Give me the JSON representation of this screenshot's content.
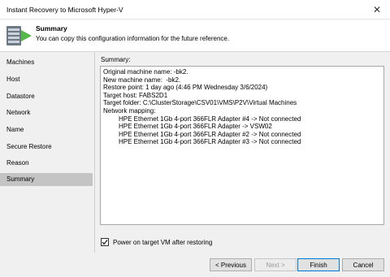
{
  "window": {
    "title": "Instant Recovery to Microsoft Hyper-V",
    "close_glyph": "✕"
  },
  "header": {
    "title": "Summary",
    "description": "You can copy this configuration information for the future reference."
  },
  "sidebar": {
    "items": [
      {
        "label": "Machines"
      },
      {
        "label": "Host"
      },
      {
        "label": "Datastore"
      },
      {
        "label": "Network"
      },
      {
        "label": "Name"
      },
      {
        "label": "Secure Restore"
      },
      {
        "label": "Reason"
      },
      {
        "label": "Summary"
      }
    ],
    "active_index": 7
  },
  "main": {
    "summary_label": "Summary:",
    "summary_lines": [
      {
        "text": "Original machine name:        -bk2.",
        "indent": false
      },
      {
        "text": "New machine name:         -bk2.",
        "indent": false
      },
      {
        "text": "Restore point: 1 day ago (4:46 PM Wednesday 3/6/2024)",
        "indent": false
      },
      {
        "text": "Target host: FABS2D1",
        "indent": false
      },
      {
        "text": "Target folder: C:\\ClusterStorage\\CSV01\\VMS\\P2V\\Virtual Machines",
        "indent": false
      },
      {
        "text": "Network mapping:",
        "indent": false
      },
      {
        "text": "HPE Ethernet 1Gb 4-port 366FLR Adapter #4 -> Not connected",
        "indent": true
      },
      {
        "text": "HPE Ethernet 1Gb 4-port 366FLR Adapter -> VSW02",
        "indent": true
      },
      {
        "text": "HPE Ethernet 1Gb 4-port 366FLR Adapter #2 -> Not connected",
        "indent": true
      },
      {
        "text": "HPE Ethernet 1Gb 4-port 366FLR Adapter #3 -> Not connected",
        "indent": true
      }
    ],
    "power_on": {
      "label": "Power on target VM after restoring",
      "checked": true
    }
  },
  "footer": {
    "previous": "< Previous",
    "next": "Next >",
    "finish": "Finish",
    "cancel": "Cancel"
  },
  "colors": {
    "accent_green": "#54b948",
    "active_item_bg": "#c4c4c4"
  }
}
